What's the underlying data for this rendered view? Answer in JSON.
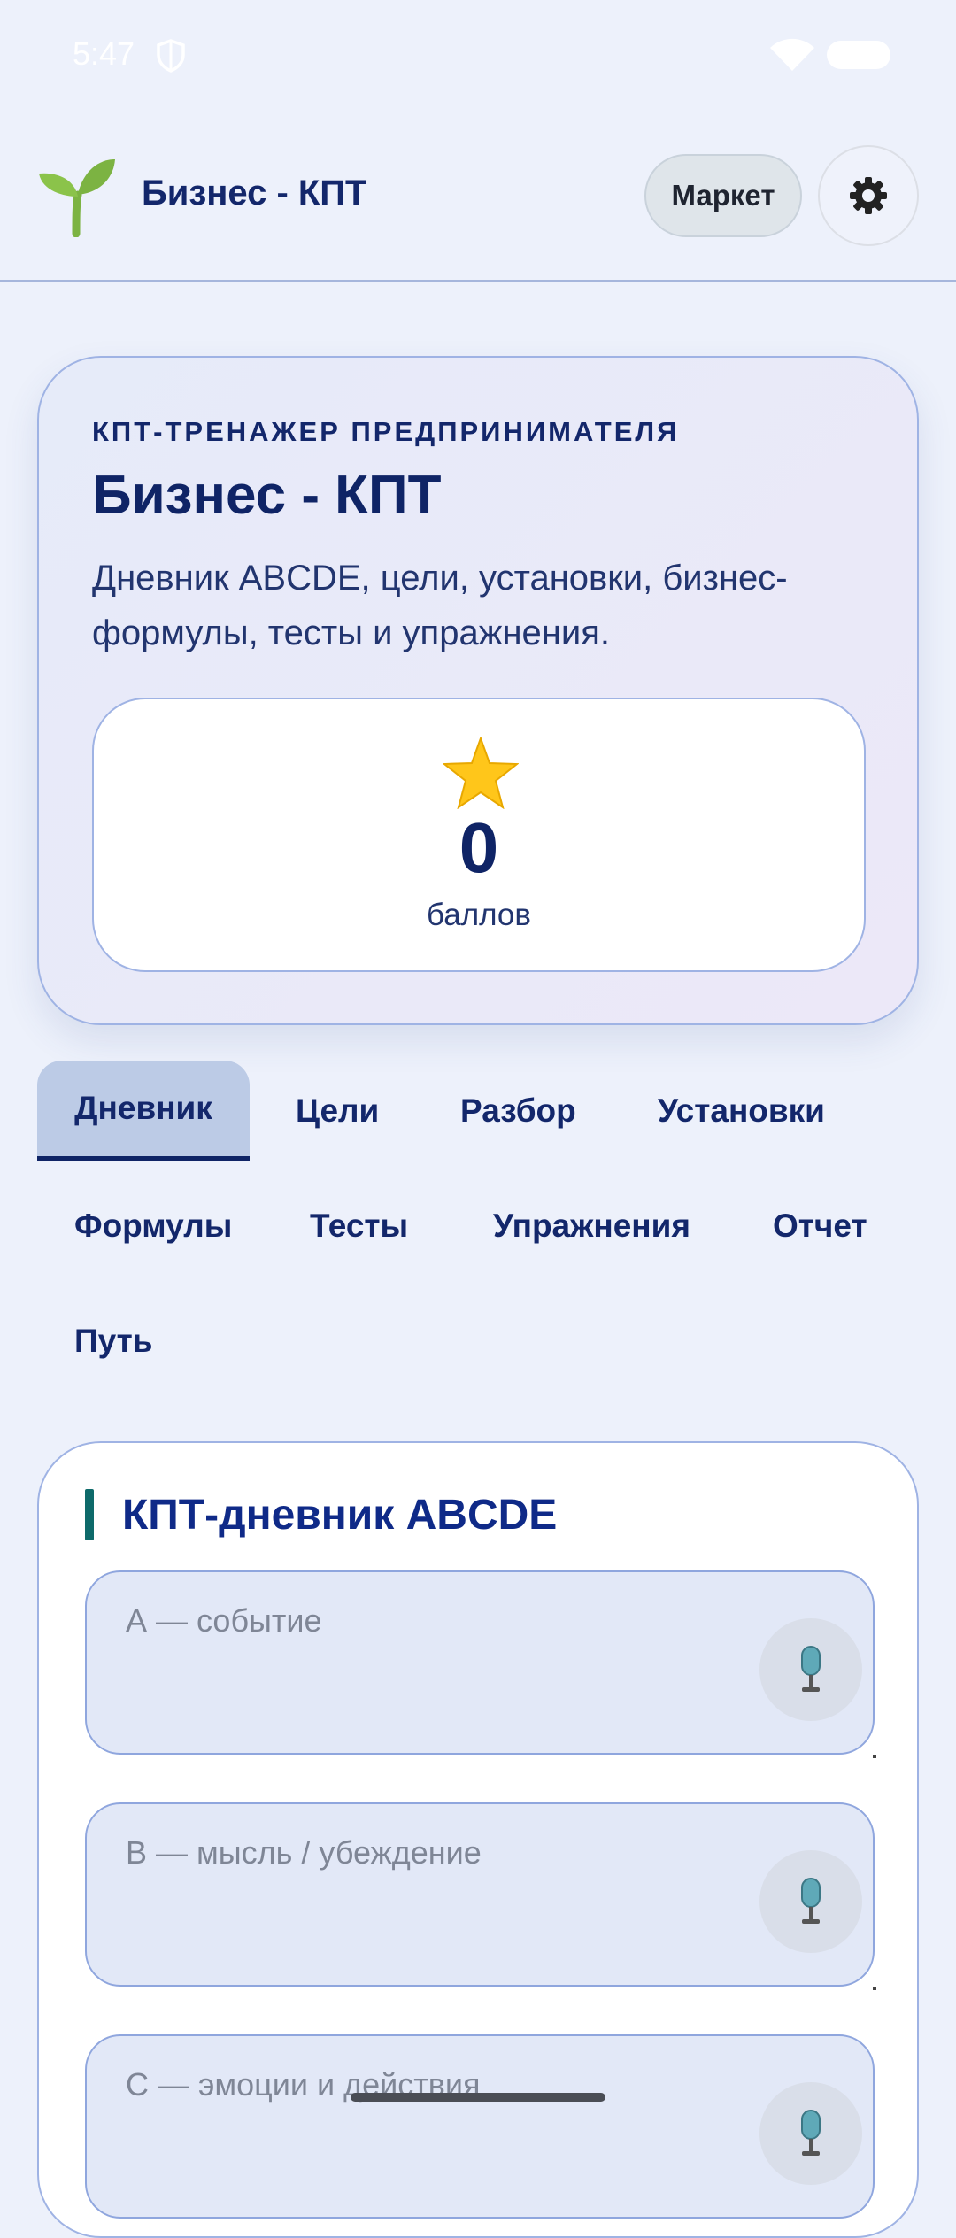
{
  "status_bar": {
    "time": "5:47"
  },
  "header": {
    "title": "Бизнес - КПТ",
    "market_label": "Маркет"
  },
  "hero": {
    "overline": "КПТ-ТРЕНАЖЕР ПРЕДПРИНИМАТЕЛЯ",
    "title": "Бизнес - КПТ",
    "description": "Дневник ABCDE, цели, установки, бизнес-формулы, тесты и упражнения.",
    "score": {
      "value": "0",
      "label": "баллов"
    }
  },
  "tabs": [
    {
      "label": "Дневник",
      "active": true
    },
    {
      "label": "Цели"
    },
    {
      "label": "Разбор"
    },
    {
      "label": "Установки"
    },
    {
      "label": "Формулы"
    },
    {
      "label": "Тесты"
    },
    {
      "label": "Упражнения"
    },
    {
      "label": "Отчет"
    },
    {
      "label": "Путь"
    }
  ],
  "diary": {
    "title": "КПТ-дневник ABCDE",
    "fields": [
      {
        "placeholder": "А — событие"
      },
      {
        "placeholder": "В — мысль / убеждение"
      },
      {
        "placeholder": "С — эмоции и действия"
      }
    ]
  },
  "colors": {
    "primary": "#13276b",
    "accent_bar": "#0e6a6a",
    "background": "#edf1fb",
    "active_tab": "#bccbe6"
  }
}
